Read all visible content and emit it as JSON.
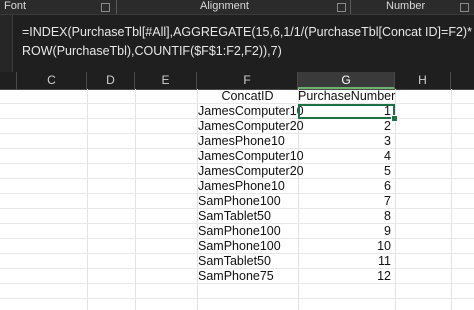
{
  "ribbon": {
    "groups": [
      "Font",
      "Alignment",
      "Number"
    ]
  },
  "formula_bar": {
    "line1": "=INDEX(PurchaseTbl[#All],AGGREGATE(15,6,1/1/(PurchaseTbl[Concat ID]=F2)*",
    "line2": "ROW(PurchaseTbl),COUNTIF($F$1:F2,F2)),7)"
  },
  "columns": [
    "C",
    "D",
    "E",
    "F",
    "G",
    "H"
  ],
  "selected_column": "G",
  "table": {
    "headers": {
      "f": "ConcatID",
      "g": "PurchaseNumber"
    },
    "rows": [
      {
        "f": "JamesComputer10",
        "g": "1"
      },
      {
        "f": "JamesComputer20",
        "g": "2"
      },
      {
        "f": "JamesPhone10",
        "g": "3"
      },
      {
        "f": "JamesComputer10",
        "g": "4"
      },
      {
        "f": "JamesComputer20",
        "g": "5"
      },
      {
        "f": "JamesPhone10",
        "g": "6"
      },
      {
        "f": "SamPhone100",
        "g": "7"
      },
      {
        "f": "SamTablet50",
        "g": "8"
      },
      {
        "f": "SamPhone100",
        "g": "9"
      },
      {
        "f": "SamPhone100",
        "g": "10"
      },
      {
        "f": "SamTablet50",
        "g": "11"
      },
      {
        "f": "SamPhone75",
        "g": "12"
      }
    ]
  },
  "colors": {
    "ribbon_bg": "#2b2b2b",
    "formula_bg": "#1f1f1f",
    "selection_green": "#1e7145"
  }
}
